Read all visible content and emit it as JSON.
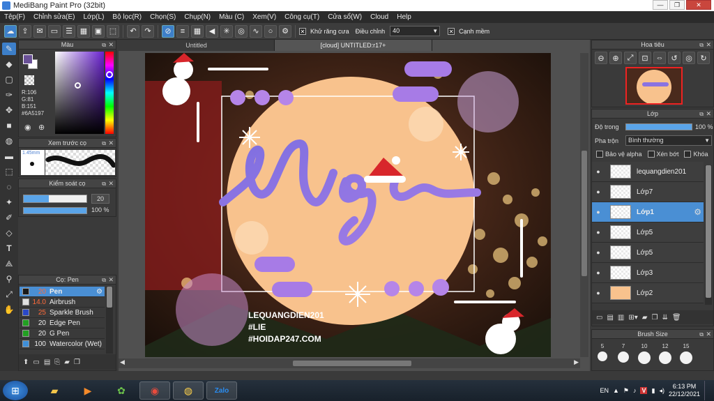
{
  "window": {
    "title": "MediBang Paint Pro (32bit)",
    "buttons": [
      "—",
      "❐",
      "✕"
    ]
  },
  "menu": [
    "Tệp(F)",
    "Chỉnh sửa(E)",
    "Lớp(L)",
    "Bộ lọc(R)",
    "Chọn(S)",
    "Chụp(N)",
    "Màu (C)",
    "Xem(V)",
    "Công cụ(T)",
    "Cửa sổ(W)",
    "Cloud",
    "Help"
  ],
  "toolbar": {
    "antialias_label": "Khử răng cưa",
    "adjust_label": "Điều chỉnh",
    "adjust_value": "40",
    "smooth_label": "Cạnh mềm"
  },
  "color_panel": {
    "title": "Màu",
    "r": "R:106",
    "g": "G:81",
    "b": "B:151",
    "hex": "#6A5197",
    "current_color": "#6a5197"
  },
  "preview_panel": {
    "title": "Xem trước cọ",
    "size": "1.45mm"
  },
  "brush_control": {
    "title": "Kiểm soát cọ",
    "size_value": "20",
    "opacity_value": "100 %"
  },
  "brush_list": {
    "title": "Cọ: Pen",
    "items": [
      {
        "color": "#1a1a1a",
        "size": "20",
        "name": "Pen",
        "selected": true
      },
      {
        "color": "#e0e0e0",
        "size": "14.0",
        "name": "Airbrush",
        "selected": false
      },
      {
        "color": "#2a48c8",
        "size": "25",
        "name": "Sparkle Brush",
        "selected": false
      },
      {
        "color": "#22a022",
        "size": "20",
        "name": "Edge Pen",
        "selected": false
      },
      {
        "color": "#22a022",
        "size": "20",
        "name": "G Pen",
        "selected": false
      },
      {
        "color": "#3f8fd8",
        "size": "100",
        "name": "Watercolor (Wet)",
        "selected": false
      }
    ]
  },
  "canvas": {
    "tabs": [
      "Untitled",
      "[cloud] UNTITLED:r17+"
    ],
    "watermark": [
      "LEQUANGDIEN201",
      "#LIE",
      "#HOIDAP247.COM"
    ],
    "logo_text": "Nigi"
  },
  "navigator": {
    "title": "Hoa tiêu"
  },
  "layers": {
    "title": "Lớp",
    "opacity_label": "Độ trong",
    "opacity_value": "100 %",
    "blend_label": "Pha trộn",
    "blend_value": "Bình thường",
    "protect_alpha": "Bảo vệ alpha",
    "clipping": "Xén bớt",
    "lock": "Khóa",
    "items": [
      {
        "name": "lequangdien201",
        "selected": false
      },
      {
        "name": "Lớp7",
        "selected": false
      },
      {
        "name": "Lớp1",
        "selected": true
      },
      {
        "name": "Lớp5",
        "selected": false
      },
      {
        "name": "Lớp5",
        "selected": false
      },
      {
        "name": "Lớp3",
        "selected": false
      },
      {
        "name": "Lớp2",
        "selected": false
      }
    ]
  },
  "brush_size_panel": {
    "title": "Brush Size",
    "sizes": [
      "5",
      "7",
      "10",
      "12",
      "15"
    ]
  },
  "taskbar": {
    "language": "EN",
    "time": "6:13 PM",
    "date": "22/12/2021"
  }
}
